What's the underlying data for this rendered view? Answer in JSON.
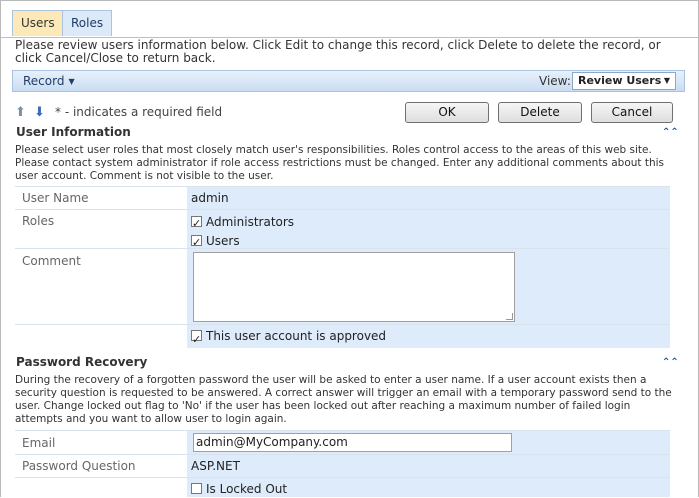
{
  "tabs": [
    "Users",
    "Roles"
  ],
  "intro": "Please review users information below. Click Edit to change this record, click Delete to delete the record, or click Cancel/Close to return back.",
  "actionbar": {
    "record_label": "Record",
    "view_label": "View:",
    "view_value": "Review Users"
  },
  "toolbar": {
    "required_note": "* - indicates a required field",
    "ok": "OK",
    "delete": "Delete",
    "cancel": "Cancel"
  },
  "user_info": {
    "title": "User Information",
    "description": "Please select user roles that most closely match user's responsibilities. Roles control access to the areas of this web site. Please contact system administrator if role access restrictions must be changed. Enter any additional comments about this user account. Comment is not visible to the user.",
    "fields": {
      "user_name_label": "User Name",
      "user_name_value": "admin",
      "roles_label": "Roles",
      "roles": [
        "Administrators",
        "Users"
      ],
      "comment_label": "Comment",
      "comment_value": "",
      "approved_label": "This user account is approved"
    }
  },
  "password_recovery": {
    "title": "Password Recovery",
    "description": "During the recovery of a forgotten password the user will be asked to enter a user name. If a user account exists then a security question is requested to be answered. A correct answer will trigger an email with a temporary password send to the user. Change locked out flag to 'No' if the user has been locked out after reaching a maximum number of failed login attempts and you want to allow user to login again.",
    "fields": {
      "email_label": "Email",
      "email_value": "admin@MyCompany.com",
      "question_label": "Password Question",
      "question_value": "ASP.NET",
      "locked_label": "Is Locked Out"
    }
  }
}
